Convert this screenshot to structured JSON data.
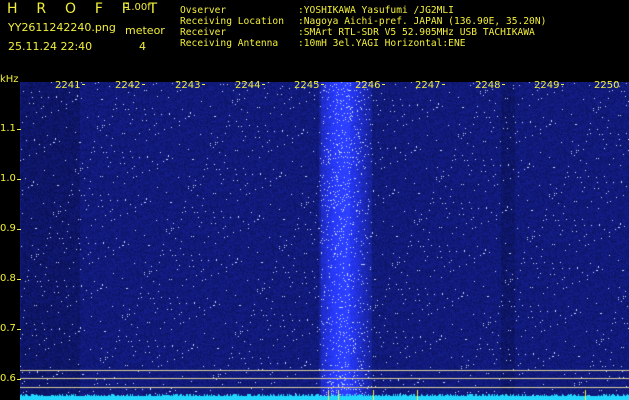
{
  "header": {
    "title": "H R O F F T",
    "version": "1.00f",
    "file_name": "YY2611242240.png",
    "date_time": "25.11.24 22:40",
    "meteor_label": "meteor",
    "meteor_count": "4"
  },
  "info": [
    {
      "key": "Ovserver",
      "value": ":YOSHIKAWA Yasufumi /JG2MLI"
    },
    {
      "key": "Receiving Location",
      "value": ":Nagoya Aichi-pref. JAPAN (136.90E, 35.20N)"
    },
    {
      "key": "Receiver",
      "value": ":SMArt RTL-SDR V5 52.905MHz USB TACHIKAWA"
    },
    {
      "key": "Receiving Antenna",
      "value": ":10mH 3el.YAGI Horizontal:ENE"
    }
  ],
  "axis": {
    "y_unit": "kHz",
    "y_ticks": [
      "1.1",
      "1.0",
      "0.9",
      "0.8",
      "0.7",
      "0.6"
    ],
    "x_ticks": [
      "2241",
      "2242",
      "2243",
      "2244",
      "2245",
      "2246",
      "2247",
      "2248",
      "2249",
      "2250"
    ]
  },
  "colors": {
    "text": "#f2ef3a",
    "background": "#000000",
    "noise": "#0a147a",
    "signal_band": "#2a3cc8",
    "baseline": "#21d6ff"
  }
}
